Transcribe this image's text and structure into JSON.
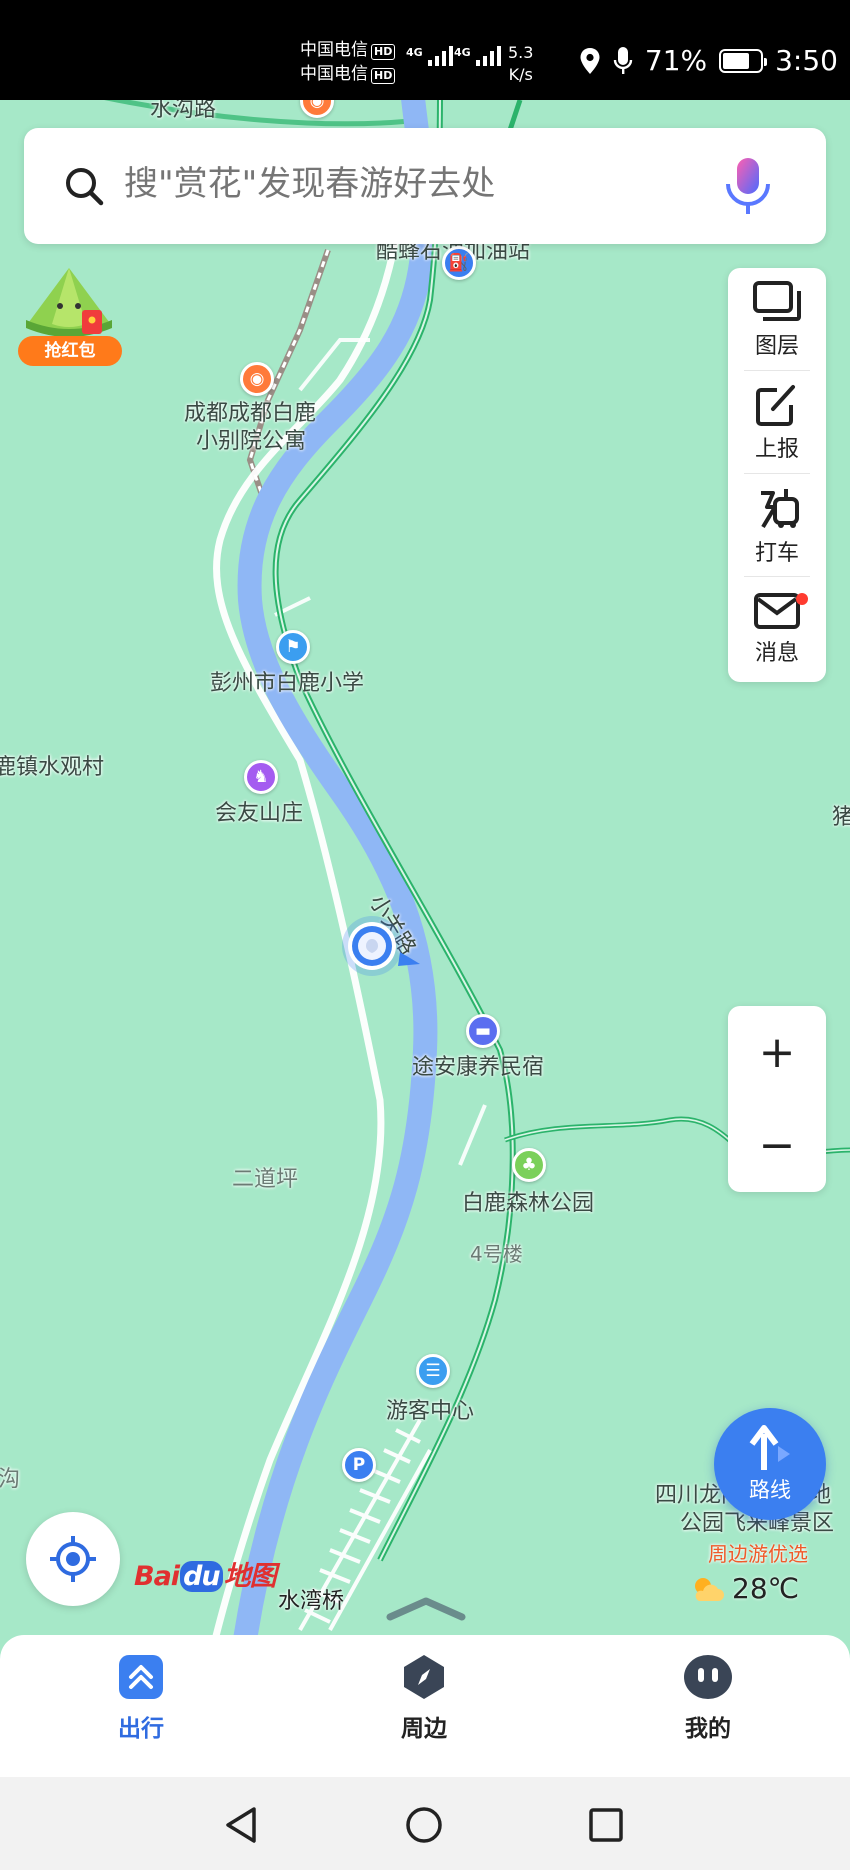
{
  "status_bar": {
    "carrier_1": "中国电信",
    "carrier_2": "中国电信",
    "hd_badge": "HD",
    "network_1": "4G",
    "network_2": "4G",
    "net_speed_value": "5.3",
    "net_speed_unit": "K/s",
    "battery": "71%",
    "battery_level": 0.71,
    "time": "3:50"
  },
  "search": {
    "placeholder": "搜\"赏花\"发现春游好去处"
  },
  "promo": {
    "label": "抢红包"
  },
  "toolbar": {
    "items": [
      {
        "label": "图层",
        "icon": "layers-icon"
      },
      {
        "label": "上报",
        "icon": "report-edit-icon"
      },
      {
        "label": "打车",
        "icon": "taxi-icon"
      },
      {
        "label": "消息",
        "icon": "mail-icon"
      }
    ]
  },
  "zoom": {
    "in": "+",
    "out": "−"
  },
  "map": {
    "labels": {
      "road_top": "水沟路",
      "gas": "酷蜂石油加油站",
      "apartment_1": "成都成都白鹿",
      "apartment_2": "小别院公寓",
      "school": "彭州市白鹿小学",
      "village": "鹿镇水观村",
      "inn": "会友山庄",
      "road": "小关路",
      "bnb": "途安康养民宿",
      "area": "二道坪",
      "park": "白鹿森林公园",
      "building": "4号楼",
      "visitor": "游客中心",
      "left_edge": "沟",
      "right_edge": "猪",
      "scenic_1": "四川龙门山国家地",
      "scenic_2": "公园飞来峰景区",
      "scenic_tag": "周边游优选",
      "bridge": "水湾桥"
    }
  },
  "route_button": {
    "label": "路线"
  },
  "logo": {
    "bai": "Bai",
    "du": "du",
    "map": "地图"
  },
  "weather": {
    "temp": "28℃"
  },
  "bottom_nav": [
    {
      "label": "出行",
      "active": true
    },
    {
      "label": "周边",
      "active": false
    },
    {
      "label": "我的",
      "active": false
    }
  ],
  "colors": {
    "map_bg": "#a6e8c8",
    "river": "#8fb7f5",
    "road_green": "#2bb36b",
    "accent_blue": "#3b7ff0"
  }
}
